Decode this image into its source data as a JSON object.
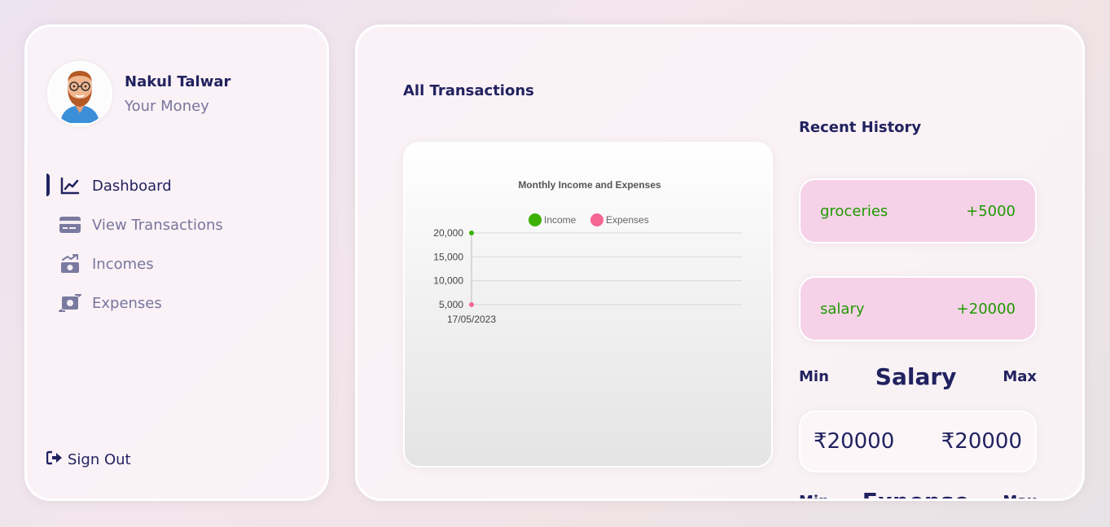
{
  "user": {
    "name": "Nakul Talwar",
    "subtitle": "Your Money"
  },
  "nav": [
    {
      "label": "Dashboard",
      "icon": "chart-line-icon",
      "active": true
    },
    {
      "label": "View Transactions",
      "icon": "credit-card-icon",
      "active": false
    },
    {
      "label": "Incomes",
      "icon": "money-bill-trend-up-icon",
      "active": false
    },
    {
      "label": "Expenses",
      "icon": "money-bill-transfer-icon",
      "active": false
    }
  ],
  "sign_out": "Sign Out",
  "main": {
    "title": "All Transactions",
    "recent_title": "Recent History",
    "history": [
      {
        "title": "groceries",
        "amount": "+5000"
      },
      {
        "title": "salary",
        "amount": "+20000"
      }
    ],
    "salary": {
      "min_label": "Min",
      "title": "Salary",
      "max_label": "Max",
      "min_value": "₹20000",
      "max_value": "₹20000"
    },
    "expense": {
      "min_label": "Min",
      "title": "Expense",
      "max_label": "Max"
    }
  },
  "colors": {
    "accent": "#222260",
    "income": "#3cb100",
    "expenses": "#f56692",
    "history_bg": "#f6d2e8",
    "history_text": "#1f9900"
  },
  "chart_data": {
    "type": "line",
    "title": "Monthly Income and Expenses",
    "x": [
      "17/05/2023"
    ],
    "series": [
      {
        "name": "Income",
        "values": [
          20000
        ],
        "color": "#3cb100"
      },
      {
        "name": "Expenses",
        "values": [
          5000
        ],
        "color": "#f56692"
      }
    ],
    "ylim": [
      5000,
      20000
    ],
    "yticks": [
      "20,000",
      "15,000",
      "10,000",
      "5,000"
    ],
    "legend": "top",
    "grid": true
  }
}
